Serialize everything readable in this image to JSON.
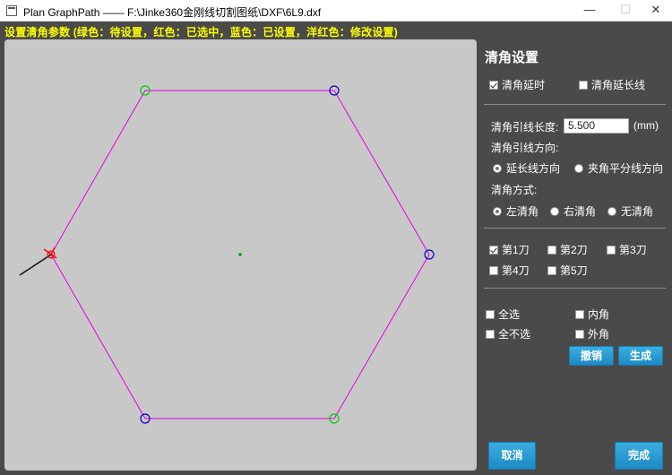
{
  "window": {
    "title": "Plan GraphPath —— F:\\Jinke360金刚线切割图纸\\DXF\\6L9.dxf",
    "min_glyph": "—",
    "max_glyph": "☐",
    "close_glyph": "✕"
  },
  "hint": "设置清角参数 (绿色：待设置，红色：已选中，蓝色：已设置，洋红色：修改设置)",
  "colors": {
    "pending": "#00d000",
    "selected": "#ff0000",
    "set": "#0000cc",
    "modify": "#ff00ff",
    "hint_text": "#ffff00"
  },
  "panel": {
    "title": "清角设置",
    "delay": {
      "label": "清角延时",
      "checked": true
    },
    "extend": {
      "label": "清角延长线",
      "checked": false
    },
    "lead_length": {
      "label": "清角引线长度:",
      "value": "5.500",
      "unit": "(mm)"
    },
    "lead_direction": {
      "label": "清角引线方向:",
      "options": [
        {
          "label": "延长线方向",
          "selected": true
        },
        {
          "label": "夹角平分线方向",
          "selected": false
        }
      ]
    },
    "mode": {
      "label": "清角方式:",
      "options": [
        {
          "label": "左清角",
          "selected": true
        },
        {
          "label": "右清角",
          "selected": false
        },
        {
          "label": "无清角",
          "selected": false
        }
      ]
    },
    "cuts": [
      {
        "label": "第1刀",
        "checked": true
      },
      {
        "label": "第2刀",
        "checked": false
      },
      {
        "label": "第3刀",
        "checked": false
      },
      {
        "label": "第4刀",
        "checked": false
      },
      {
        "label": "第5刀",
        "checked": false
      }
    ],
    "select_all": "全选",
    "select_none": "全不选",
    "inner_corner": "内角",
    "outer_corner": "外角",
    "undo_button": "撤销",
    "generate_button": "生成",
    "cancel_button": "取消",
    "finish_button": "完成"
  },
  "drawing": {
    "shape": "hexagon",
    "vertices": [
      {
        "name": "top-left",
        "status": "pending"
      },
      {
        "name": "top-right",
        "status": "set"
      },
      {
        "name": "right",
        "status": "set"
      },
      {
        "name": "bottom-right",
        "status": "pending"
      },
      {
        "name": "bottom-left",
        "status": "set"
      },
      {
        "name": "left",
        "status": "selected"
      }
    ]
  }
}
